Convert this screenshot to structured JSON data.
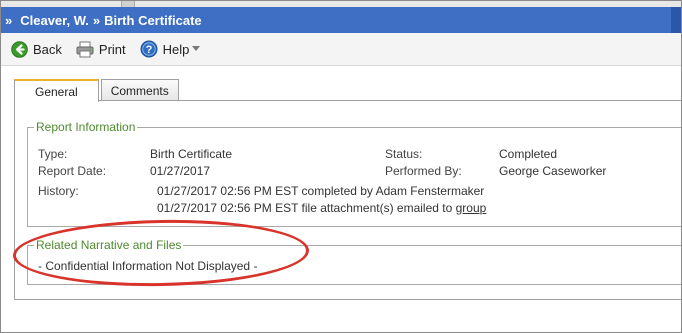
{
  "breadcrumb": {
    "prefix": "»",
    "person": "Cleaver, W.",
    "separator": "»",
    "page": "Birth Certificate"
  },
  "toolbar": {
    "back_label": "Back",
    "print_label": "Print",
    "help_label": "Help"
  },
  "tabs": [
    {
      "label": "General",
      "active": true
    },
    {
      "label": "Comments",
      "active": false
    }
  ],
  "report_information": {
    "title": "Report Information",
    "type_label": "Type:",
    "type_value": "Birth Certificate",
    "report_date_label": "Report Date:",
    "report_date_value": "01/27/2017",
    "status_label": "Status:",
    "status_value": "Completed",
    "performed_by_label": "Performed By:",
    "performed_by_value": "George Caseworker",
    "history_label": "History:",
    "history_line1": "01/27/2017 02:56 PM EST completed by Adam Fenstermaker",
    "history_line2_prefix": "01/27/2017 02:56 PM EST file attachment(s) emailed to",
    "history_line2_link": "group"
  },
  "related_narrative": {
    "title": "Related Narrative and Files",
    "message": "- Confidential Information Not Displayed -"
  },
  "colors": {
    "titlebar": "#3e6fc4",
    "legend_green": "#4e8a2e",
    "highlight_red": "#d9342b",
    "active_tab_accent": "#f0b030"
  }
}
